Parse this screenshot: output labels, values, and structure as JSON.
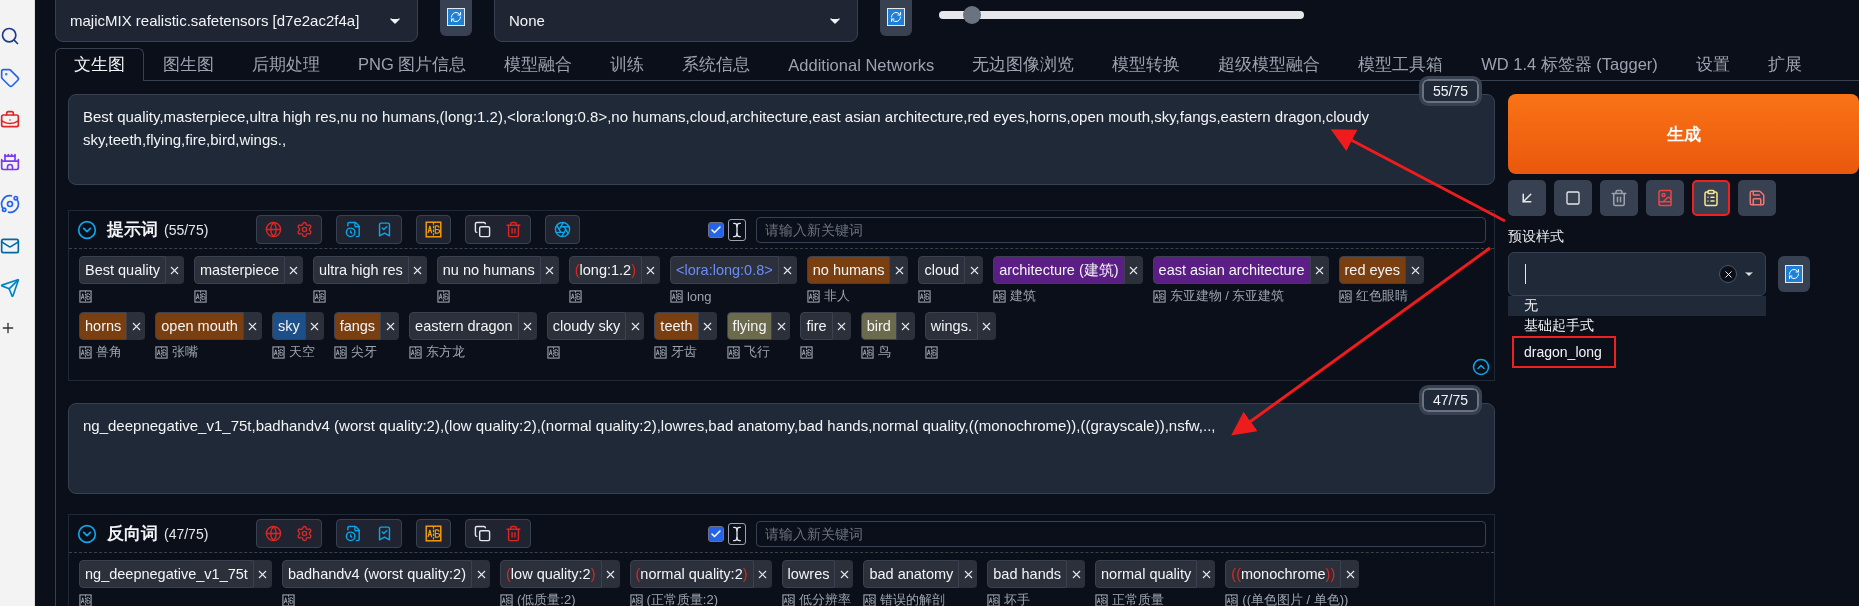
{
  "top_bar": {
    "checkpoint": "majicMIX realistic.safetensors [d7e2ac2f4a]",
    "vae": "None",
    "slider": {
      "level": 0.09
    }
  },
  "tabs": [
    {
      "label": "文生图",
      "selected": true
    },
    {
      "label": "图生图",
      "selected": false
    },
    {
      "label": "后期处理",
      "selected": false
    },
    {
      "label": "PNG 图片信息",
      "selected": false
    },
    {
      "label": "模型融合",
      "selected": false
    },
    {
      "label": "训练",
      "selected": false
    },
    {
      "label": "系统信息",
      "selected": false
    },
    {
      "label": "Additional Networks",
      "selected": false
    },
    {
      "label": "无边图像浏览",
      "selected": false
    },
    {
      "label": "模型转换",
      "selected": false
    },
    {
      "label": "超级模型融合",
      "selected": false
    },
    {
      "label": "模型工具箱",
      "selected": false
    },
    {
      "label": "WD 1.4 标签器 (Tagger)",
      "selected": false
    },
    {
      "label": "设置",
      "selected": false
    },
    {
      "label": "扩展",
      "selected": false
    }
  ],
  "prompt": {
    "value": "Best quality,masterpiece,ultra high res,nu no humans,(long:1.2),<lora:long:0.8>,no humans,cloud,architecture,east asian architecture,red eyes,horns,open mouth,sky,fangs,eastern dragon,cloudy sky,teeth,flying,fire,bird,wings.,",
    "counter": "55/75"
  },
  "prompt_tags": {
    "title": "提示词",
    "count": "(55/75)",
    "ai_button": true,
    "auto_checked": true,
    "placeholder": "请输入新关键词",
    "collapse_button": true,
    "lines": [
      {
        "tags": [
          {
            "kind": "tag",
            "text": "Best quality",
            "color": "#2b303b"
          },
          {
            "kind": "tag",
            "text": "masterpiece",
            "color": "#2b303b"
          },
          {
            "kind": "tag",
            "text": "ultra high res",
            "color": "#2b303b"
          },
          {
            "kind": "tag",
            "text": "nu no humans",
            "color": "#2b303b"
          },
          {
            "kind": "tag",
            "open": "(",
            "text": "long:1.2",
            "close": ")",
            "color": "#2b303b"
          },
          {
            "kind": "lora",
            "text": "<lora:long:0.8>",
            "color": "#2b303b",
            "translation": "long"
          },
          {
            "kind": "tag",
            "text": "no humans",
            "color": "#7a3f10",
            "translation": "非人"
          },
          {
            "kind": "tag",
            "text": "cloud",
            "color": "#2b303b"
          },
          {
            "kind": "tag",
            "text": "architecture (建筑)",
            "color": "#5b1e85",
            "translation": "建筑"
          },
          {
            "kind": "tag",
            "text": "east asian architecture",
            "color": "#5b1e85",
            "translation": "东亚建物 / 东亚建筑"
          },
          {
            "kind": "tag",
            "text": "red eyes",
            "color": "#7a3f10",
            "translation": "红色眼睛"
          }
        ]
      },
      {
        "tags": [
          {
            "kind": "tag",
            "text": "horns",
            "color": "#7a3f10",
            "translation": "兽角"
          },
          {
            "kind": "tag",
            "text": "open mouth",
            "color": "#7a3f10",
            "translation": "张嘴"
          },
          {
            "kind": "tag",
            "text": "sky",
            "color": "#1d4f88",
            "translation": "天空"
          },
          {
            "kind": "tag",
            "text": "fangs",
            "color": "#7a3f10",
            "translation": "尖牙"
          },
          {
            "kind": "tag",
            "text": "eastern dragon",
            "color": "#2b303b",
            "translation": "东方龙"
          },
          {
            "kind": "tag",
            "text": "cloudy sky",
            "color": "#2b303b"
          },
          {
            "kind": "tag",
            "text": "teeth",
            "color": "#7a3f10",
            "translation": "牙齿"
          },
          {
            "kind": "tag",
            "text": "flying",
            "color": "#6b6a4c",
            "translation": "飞行"
          },
          {
            "kind": "tag",
            "text": "fire",
            "color": "#2b303b"
          },
          {
            "kind": "tag",
            "text": "bird",
            "color": "#6b6a4c",
            "translation": "鸟"
          },
          {
            "kind": "tag",
            "text": "wings.",
            "color": "#2b303b"
          }
        ]
      }
    ]
  },
  "negative_prompt": {
    "value": "ng_deepnegative_v1_75t,badhandv4 (worst quality:2),(low quality:2),(normal quality:2),lowres,bad anatomy,bad hands,normal quality,((monochrome)),((grayscale)),nsfw,..,",
    "counter": "47/75"
  },
  "negative_tags": {
    "title": "反向词",
    "count": "(47/75)",
    "ai_button": false,
    "auto_checked": true,
    "placeholder": "请输入新关键词",
    "collapse_button": false,
    "lines": [
      {
        "tags": [
          {
            "kind": "tag",
            "text": "ng_deepnegative_v1_75t",
            "color": "#2b303b"
          },
          {
            "kind": "tag",
            "text": "badhandv4 (worst quality:2)",
            "color": "#2b303b"
          },
          {
            "kind": "tag",
            "open": "(",
            "text": "low quality:2",
            "close": ")",
            "color": "#2b303b",
            "translation": "(低质量:2)"
          },
          {
            "kind": "tag",
            "open": "(",
            "text": "normal quality:2",
            "close": ")",
            "color": "#2b303b",
            "translation": "(正常质量:2)"
          },
          {
            "kind": "tag",
            "text": "lowres",
            "color": "#2b303b",
            "translation": "低分辨率"
          },
          {
            "kind": "tag",
            "text": "bad anatomy",
            "color": "#2b303b",
            "translation": "错误的解剖"
          },
          {
            "kind": "tag",
            "text": "bad hands",
            "color": "#2b303b",
            "translation": "坏手"
          },
          {
            "kind": "tag",
            "text": "normal quality",
            "color": "#2b303b",
            "translation": "正常质量"
          },
          {
            "kind": "tag",
            "open": "((",
            "text": "monochrome",
            "close": "))",
            "color": "#2b303b",
            "translation": "((单色图片 / 单色))"
          }
        ]
      }
    ]
  },
  "generate_button": "生成",
  "tool_buttons": [
    {
      "kind": "send",
      "highlighted": false
    },
    {
      "kind": "square",
      "highlighted": false
    },
    {
      "kind": "trash",
      "highlighted": false
    },
    {
      "kind": "card",
      "highlighted": false
    },
    {
      "kind": "paste",
      "highlighted": true
    },
    {
      "kind": "save",
      "highlighted": false
    }
  ],
  "preset": {
    "label": "预设样式",
    "options": [
      {
        "text": "无",
        "selected": true,
        "highlighted": false
      },
      {
        "text": "基础起手式",
        "selected": false,
        "highlighted": false
      },
      {
        "text": "dragon_long",
        "selected": false,
        "highlighted": true
      }
    ]
  }
}
